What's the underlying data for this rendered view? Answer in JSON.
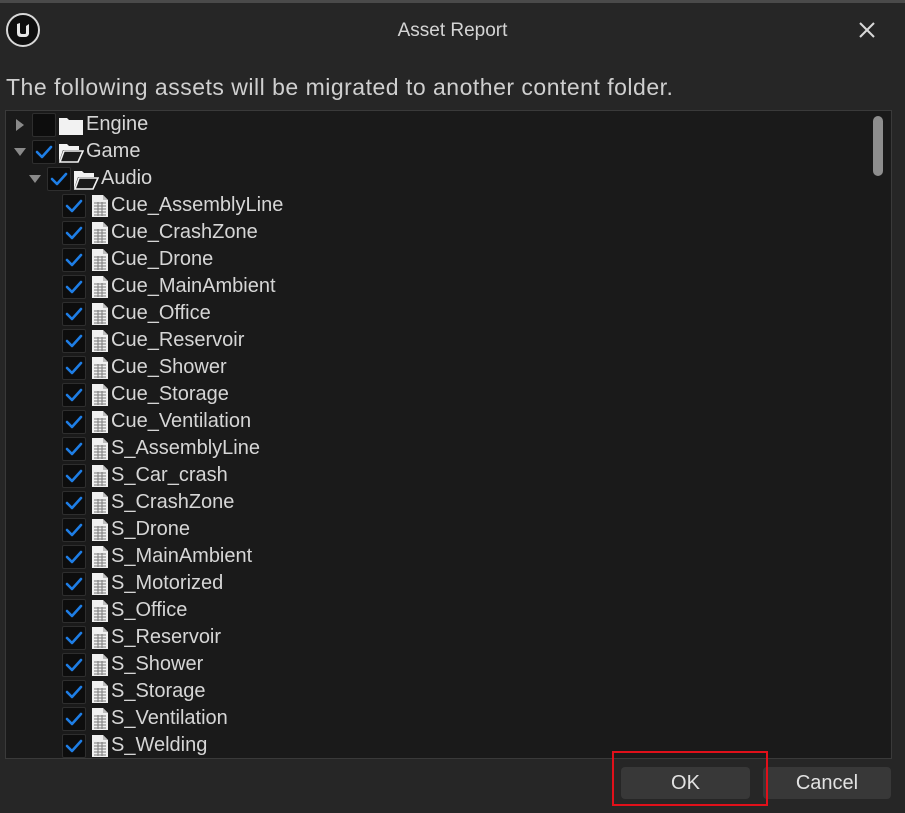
{
  "window": {
    "title": "Asset Report",
    "close_icon": "close-icon",
    "logo_icon": "unreal-logo-icon"
  },
  "message": "The following assets will be migrated to another content folder.",
  "tree": {
    "accent_color": "#1e7ee6",
    "rows": [
      {
        "label": "Engine",
        "type": "folder",
        "expanded": false,
        "checked": false,
        "depth": 0
      },
      {
        "label": "Game",
        "type": "folder",
        "expanded": true,
        "checked": true,
        "depth": 0
      },
      {
        "label": "Audio",
        "type": "folder",
        "expanded": true,
        "checked": true,
        "depth": 1
      },
      {
        "label": "Cue_AssemblyLine",
        "type": "file",
        "checked": true,
        "depth": 2
      },
      {
        "label": "Cue_CrashZone",
        "type": "file",
        "checked": true,
        "depth": 2
      },
      {
        "label": "Cue_Drone",
        "type": "file",
        "checked": true,
        "depth": 2
      },
      {
        "label": "Cue_MainAmbient",
        "type": "file",
        "checked": true,
        "depth": 2
      },
      {
        "label": "Cue_Office",
        "type": "file",
        "checked": true,
        "depth": 2
      },
      {
        "label": "Cue_Reservoir",
        "type": "file",
        "checked": true,
        "depth": 2
      },
      {
        "label": "Cue_Shower",
        "type": "file",
        "checked": true,
        "depth": 2
      },
      {
        "label": "Cue_Storage",
        "type": "file",
        "checked": true,
        "depth": 2
      },
      {
        "label": "Cue_Ventilation",
        "type": "file",
        "checked": true,
        "depth": 2
      },
      {
        "label": "S_AssemblyLine",
        "type": "file",
        "checked": true,
        "depth": 2
      },
      {
        "label": "S_Car_crash",
        "type": "file",
        "checked": true,
        "depth": 2
      },
      {
        "label": "S_CrashZone",
        "type": "file",
        "checked": true,
        "depth": 2
      },
      {
        "label": "S_Drone",
        "type": "file",
        "checked": true,
        "depth": 2
      },
      {
        "label": "S_MainAmbient",
        "type": "file",
        "checked": true,
        "depth": 2
      },
      {
        "label": "S_Motorized",
        "type": "file",
        "checked": true,
        "depth": 2
      },
      {
        "label": "S_Office",
        "type": "file",
        "checked": true,
        "depth": 2
      },
      {
        "label": "S_Reservoir",
        "type": "file",
        "checked": true,
        "depth": 2
      },
      {
        "label": "S_Shower",
        "type": "file",
        "checked": true,
        "depth": 2
      },
      {
        "label": "S_Storage",
        "type": "file",
        "checked": true,
        "depth": 2
      },
      {
        "label": "S_Ventilation",
        "type": "file",
        "checked": true,
        "depth": 2
      },
      {
        "label": "S_Welding",
        "type": "file",
        "checked": true,
        "depth": 2
      }
    ]
  },
  "buttons": {
    "ok_label": "OK",
    "cancel_label": "Cancel"
  },
  "highlight_color": "#e0101a"
}
